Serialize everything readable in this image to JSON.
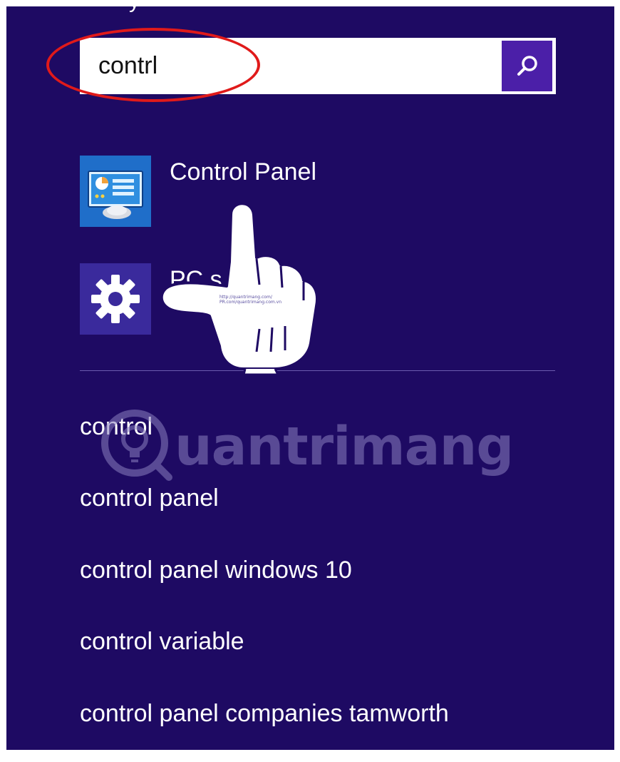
{
  "search": {
    "value": "contrl",
    "button_icon": "search-icon"
  },
  "top_fragment": "y",
  "results": [
    {
      "label": "Control Panel",
      "icon": "control-panel-icon"
    },
    {
      "label": "PC s",
      "icon": "gear-icon"
    }
  ],
  "suggestions": [
    "control",
    "control panel",
    "control panel windows 10",
    "control variable",
    "control panel companies tamworth"
  ],
  "watermark": {
    "brand": "uantrimang",
    "url_line1": "http://quantrimang.com/",
    "url_line2": "PR.com/quantrimang.com.vn"
  },
  "colors": {
    "background": "#1e0a63",
    "search_button": "#4b1fa8",
    "highlight_ellipse": "#e01a1a"
  }
}
